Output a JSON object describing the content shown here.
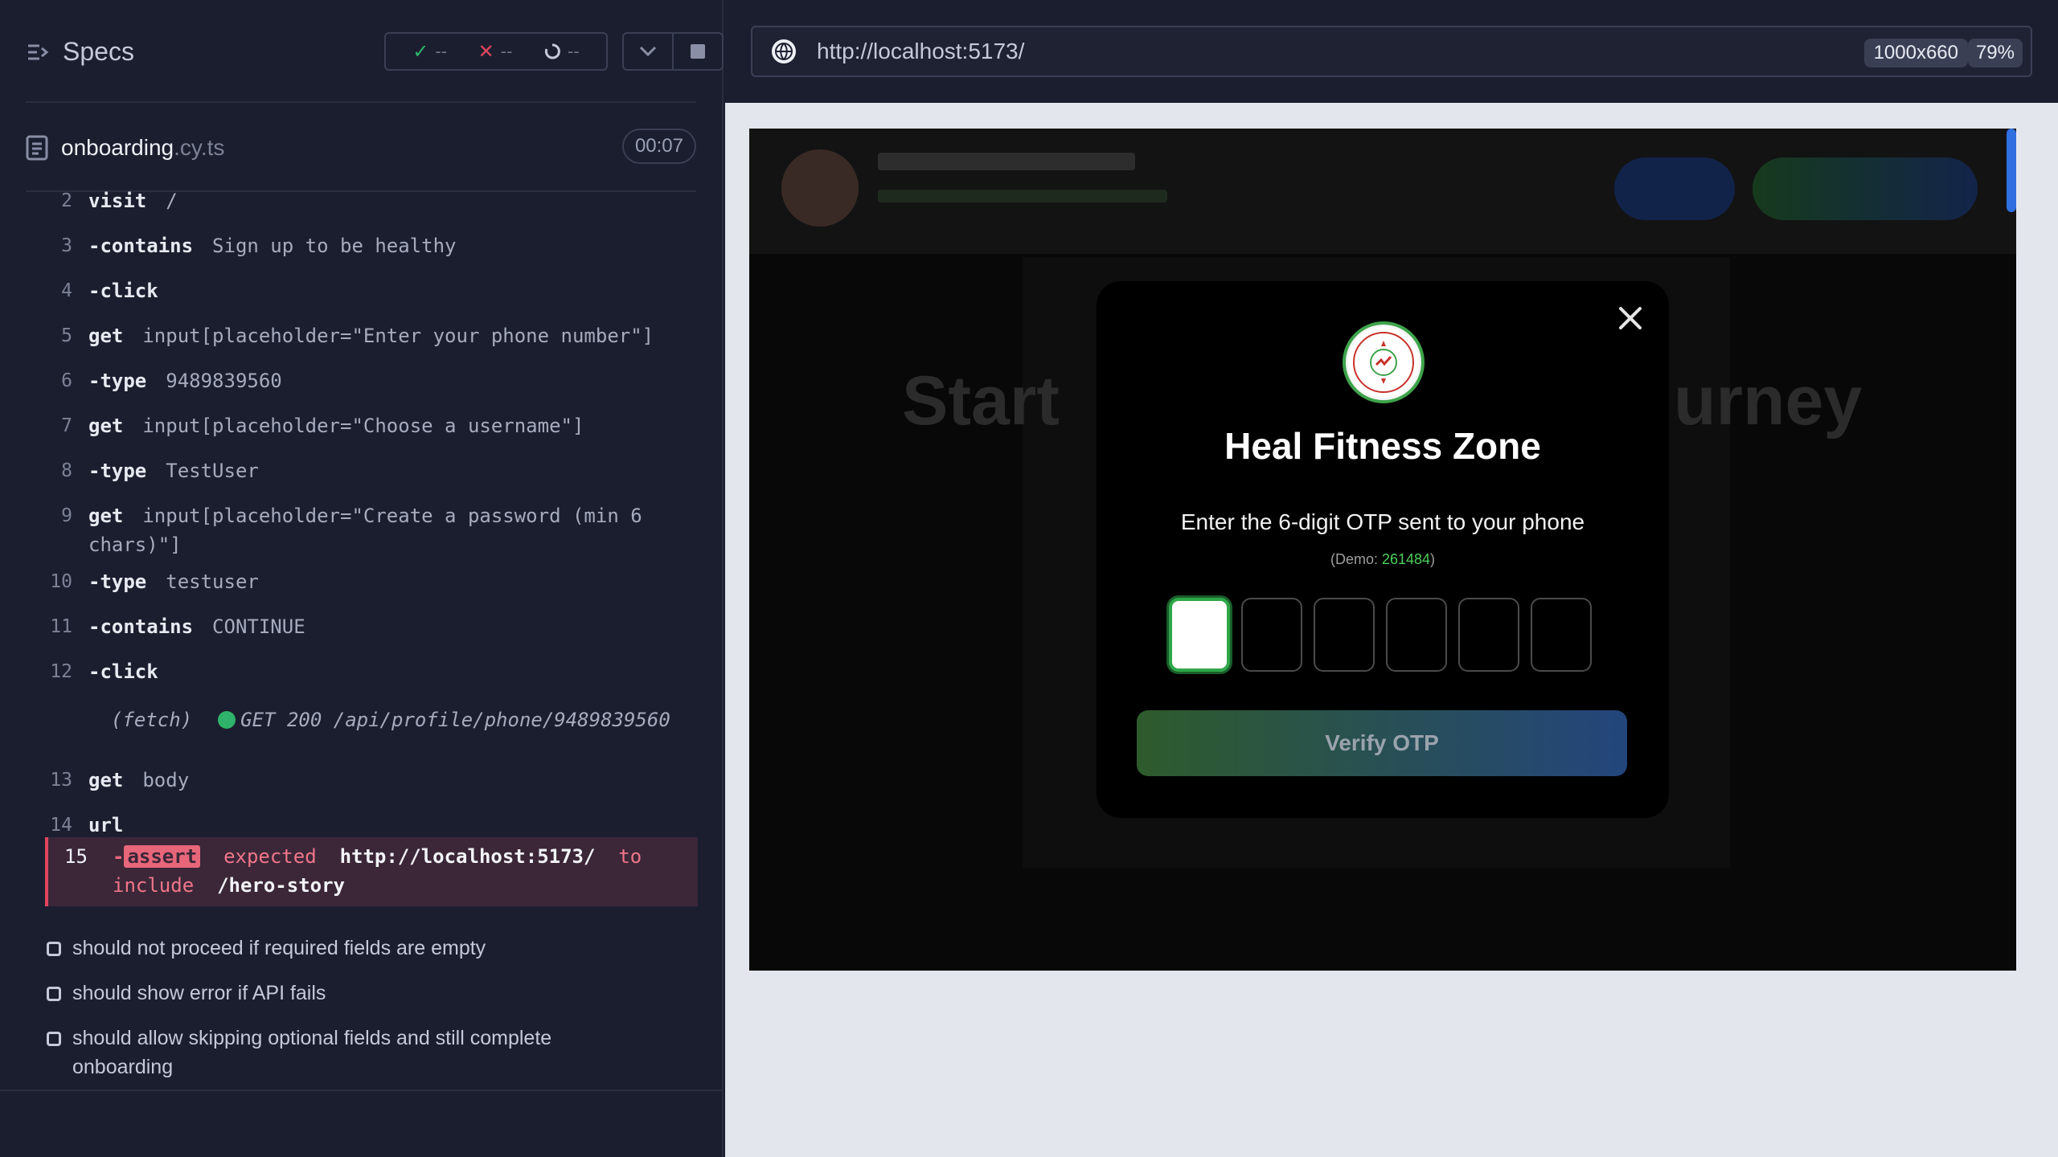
{
  "runner": {
    "specs_title": "Specs",
    "stats": {
      "passed": "--",
      "failed": "--",
      "pending": "--"
    },
    "file": {
      "name": "onboarding",
      "ext": ".cy.ts",
      "timer": "00:07"
    },
    "commands": [
      {
        "num": "2",
        "name": "visit",
        "dash": false,
        "arg": "/"
      },
      {
        "num": "3",
        "name": "contains",
        "dash": true,
        "arg": "Sign up to be healthy"
      },
      {
        "num": "4",
        "name": "click",
        "dash": true,
        "arg": ""
      },
      {
        "num": "5",
        "name": "get",
        "dash": false,
        "arg": "input[placeholder=\"Enter your phone number\"]"
      },
      {
        "num": "6",
        "name": "type",
        "dash": true,
        "arg": "9489839560"
      },
      {
        "num": "7",
        "name": "get",
        "dash": false,
        "arg": "input[placeholder=\"Choose a username\"]"
      },
      {
        "num": "8",
        "name": "type",
        "dash": true,
        "arg": "TestUser"
      },
      {
        "num": "9",
        "name": "get",
        "dash": false,
        "arg": "input[placeholder=\"Create a password (min 6 chars)\"]"
      },
      {
        "num": "10",
        "name": "type",
        "dash": true,
        "arg": "testuser"
      },
      {
        "num": "11",
        "name": "contains",
        "dash": true,
        "arg": "CONTINUE"
      },
      {
        "num": "12",
        "name": "click",
        "dash": true,
        "arg": ""
      },
      {
        "num": "13",
        "name": "get",
        "dash": false,
        "arg": "body"
      },
      {
        "num": "14",
        "name": "url",
        "dash": false,
        "arg": ""
      }
    ],
    "fetch": {
      "label": "(fetch)",
      "text": "GET 200 /api/profile/phone/9489839560"
    },
    "error": {
      "num": "15",
      "assert": "assert",
      "expected": "expected",
      "url": "http://localhost:5173/",
      "to": "to",
      "include": "include",
      "path": "/hero-story"
    },
    "tests": [
      "should not proceed if required fields are empty",
      "should show error if API fails",
      "should allow skipping optional fields and still complete onboarding"
    ]
  },
  "browser": {
    "url": "http://localhost:5173/",
    "viewport": "1000x660",
    "zoom": "79%"
  },
  "app": {
    "hero_left": "Start",
    "hero_right": "urney",
    "modal": {
      "title": "Heal Fitness Zone",
      "instruction": "Enter the 6-digit OTP sent to your phone",
      "demo_prefix": "(Demo: ",
      "demo_code": "261484",
      "demo_suffix": ")",
      "verify_label": "Verify OTP"
    }
  },
  "colors": {
    "pass": "#2fb36a",
    "fail": "#e0455f",
    "accent_green": "#4ccf5c"
  }
}
